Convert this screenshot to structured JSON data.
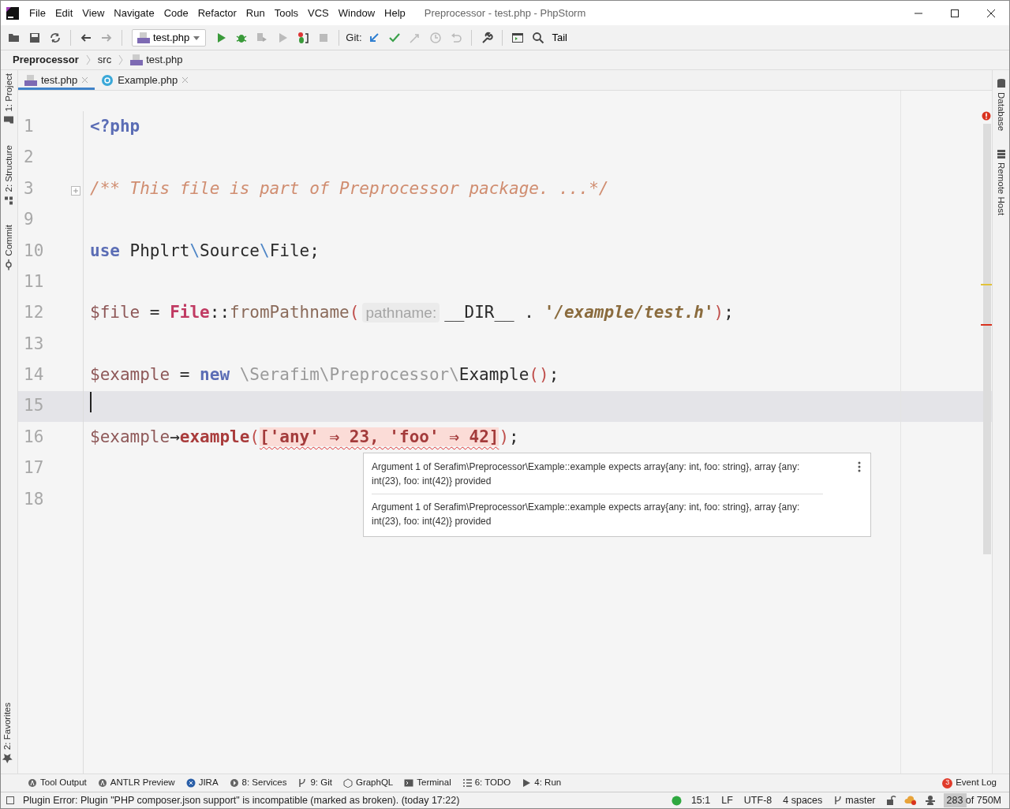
{
  "window": {
    "title": "Preprocessor - test.php - PhpStorm",
    "menu": [
      "File",
      "Edit",
      "View",
      "Navigate",
      "Code",
      "Refactor",
      "Run",
      "Tools",
      "VCS",
      "Window",
      "Help"
    ]
  },
  "toolbar": {
    "run_config": "test.php",
    "git_label": "Git:",
    "tail_label": "Tail"
  },
  "breadcrumbs": [
    {
      "label": "Preprocessor",
      "kind": "project"
    },
    {
      "label": "src",
      "kind": "folder"
    },
    {
      "label": "test.php",
      "kind": "php"
    }
  ],
  "tabs": [
    {
      "label": "test.php",
      "kind": "php",
      "selected": true
    },
    {
      "label": "Example.php",
      "kind": "class",
      "selected": false
    }
  ],
  "left_tool_windows": [
    {
      "label": "1: Project",
      "kind": "folder"
    },
    {
      "label": "2: Structure",
      "kind": "structure"
    },
    {
      "label": "Commit",
      "kind": "commit"
    }
  ],
  "left_bottom_tool_windows": [
    {
      "label": "2: Favorites",
      "kind": "star"
    }
  ],
  "right_tool_windows": [
    {
      "label": "Database",
      "kind": "db"
    },
    {
      "label": "Remote Host",
      "kind": "host"
    }
  ],
  "editor": {
    "lines": [
      {
        "number": "1",
        "current": false,
        "tokens": [
          {
            "text": "<?php",
            "kind": "keyword"
          }
        ]
      },
      {
        "number": "2",
        "current": false
      },
      {
        "number": "3",
        "current": false,
        "folded": true,
        "tokens": [
          {
            "text": "/** This file is part of Preprocessor package. ...*/",
            "kind": "comment"
          }
        ]
      },
      {
        "number": "9",
        "current": false
      },
      {
        "number": "10",
        "current": false,
        "tokens": [
          {
            "text": "use",
            "kind": "keyword"
          },
          {
            "text": " Phplrt",
            "kind": "plain"
          },
          {
            "text": "\\",
            "kind": "sep"
          },
          {
            "text": "Source",
            "kind": "plain"
          },
          {
            "text": "\\",
            "kind": "sep"
          },
          {
            "text": "File;",
            "kind": "plain"
          }
        ]
      },
      {
        "number": "11",
        "current": false
      },
      {
        "number": "12",
        "current": false,
        "tokens": [
          {
            "text": "$file",
            "kind": "variable"
          },
          {
            "text": " = ",
            "kind": "plain"
          },
          {
            "text": "File",
            "kind": "class"
          },
          {
            "text": "::",
            "kind": "plain"
          },
          {
            "text": "fromPathname",
            "kind": "method"
          },
          {
            "text": "(",
            "kind": "paren"
          },
          {
            "text": "pathname:",
            "kind": "hint"
          },
          {
            "text": "__DIR__ . ",
            "kind": "plain"
          },
          {
            "text": "'/example/test.h'",
            "kind": "string"
          },
          {
            "text": ")",
            "kind": "paren"
          },
          {
            "text": ";",
            "kind": "plain"
          }
        ]
      },
      {
        "number": "13",
        "current": false
      },
      {
        "number": "14",
        "current": false,
        "tokens": [
          {
            "text": "$example",
            "kind": "variable"
          },
          {
            "text": " = ",
            "kind": "plain"
          },
          {
            "text": "new",
            "kind": "keyword"
          },
          {
            "text": " \\Serafim\\Preprocessor\\",
            "kind": "unused"
          },
          {
            "text": "Example",
            "kind": "plain"
          },
          {
            "text": "()",
            "kind": "paren"
          },
          {
            "text": ";",
            "kind": "plain"
          }
        ]
      },
      {
        "number": "15",
        "current": true
      },
      {
        "number": "16",
        "current": false,
        "tokens": [
          {
            "text": "$example",
            "kind": "variable"
          },
          {
            "text": "→",
            "kind": "plain"
          },
          {
            "text": "example",
            "kind": "call"
          },
          {
            "text": "(",
            "kind": "paren"
          },
          {
            "text": "['any' ⇒ 23, 'foo' ⇒ 42]",
            "kind": "error"
          },
          {
            "text": ")",
            "kind": "paren"
          },
          {
            "text": ";",
            "kind": "plain"
          }
        ]
      },
      {
        "number": "17",
        "current": false
      },
      {
        "number": "18",
        "current": false
      }
    ]
  },
  "tooltip": {
    "messages": [
      "Argument 1 of Serafim\\Preprocessor\\Example::example expects array{any: int, foo: string}, array {any: int(23), foo: int(42)} provided",
      "Argument 1 of Serafim\\Preprocessor\\Example::example expects array{any: int, foo: string}, array {any: int(23), foo: int(42)} provided"
    ]
  },
  "tool_windows": [
    {
      "label": "Tool Output",
      "kind": "antlr"
    },
    {
      "label": "ANTLR Preview",
      "kind": "antlr"
    },
    {
      "label": "JIRA",
      "kind": "jira"
    },
    {
      "label": "8: Services",
      "kind": "services"
    },
    {
      "label": "9: Git",
      "kind": "branch"
    },
    {
      "label": "GraphQL",
      "kind": "graphql"
    },
    {
      "label": "Terminal",
      "kind": "terminal"
    },
    {
      "label": "6: TODO",
      "kind": "todo"
    },
    {
      "label": "4: Run",
      "kind": "run"
    }
  ],
  "event_log": {
    "label": "Event Log",
    "count": "3"
  },
  "status_bar": {
    "message": "Plugin Error: Plugin \"PHP composer.json support\" is incompatible (marked as broken). (today 17:22)",
    "position": "15:1",
    "line_separator": "LF",
    "encoding": "UTF-8",
    "indent": "4 spaces",
    "branch": "master",
    "memory": {
      "text": "283 of 750M",
      "level": 0.38
    }
  }
}
